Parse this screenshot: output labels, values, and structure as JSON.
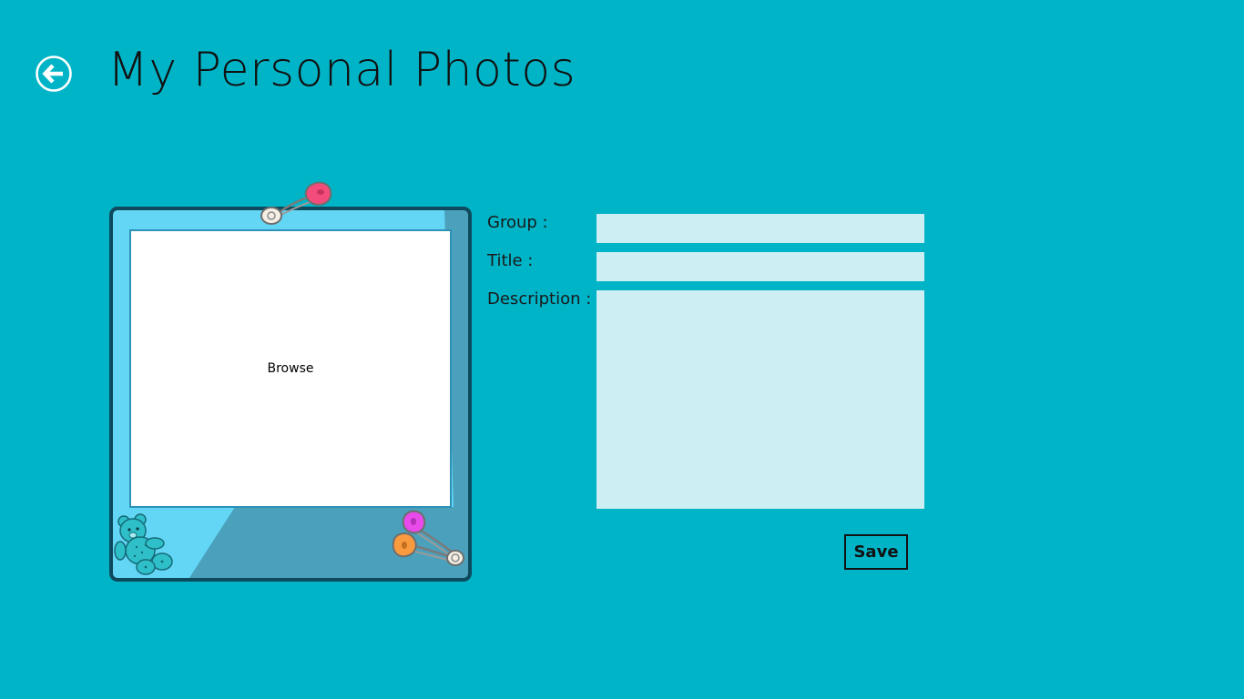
{
  "header": {
    "title": "My Personal Photos",
    "back_icon": "arrow-left-circle-icon"
  },
  "photo_frame": {
    "browse_label": "Browse",
    "decorations": [
      "safety-pin-icon",
      "teddy-bear-icon",
      "safety-pins-icon"
    ]
  },
  "form": {
    "group_label": "Group :",
    "group_value": "",
    "title_label": "Title :",
    "title_value": "",
    "description_label": "Description :",
    "description_value": "",
    "save_label": "Save"
  },
  "colors": {
    "background": "#00B4C8",
    "field_background": "#CDEFF3",
    "frame_border": "#0E4A5E",
    "frame_light": "#63D5F5",
    "frame_dark": "#4BA1BC"
  }
}
